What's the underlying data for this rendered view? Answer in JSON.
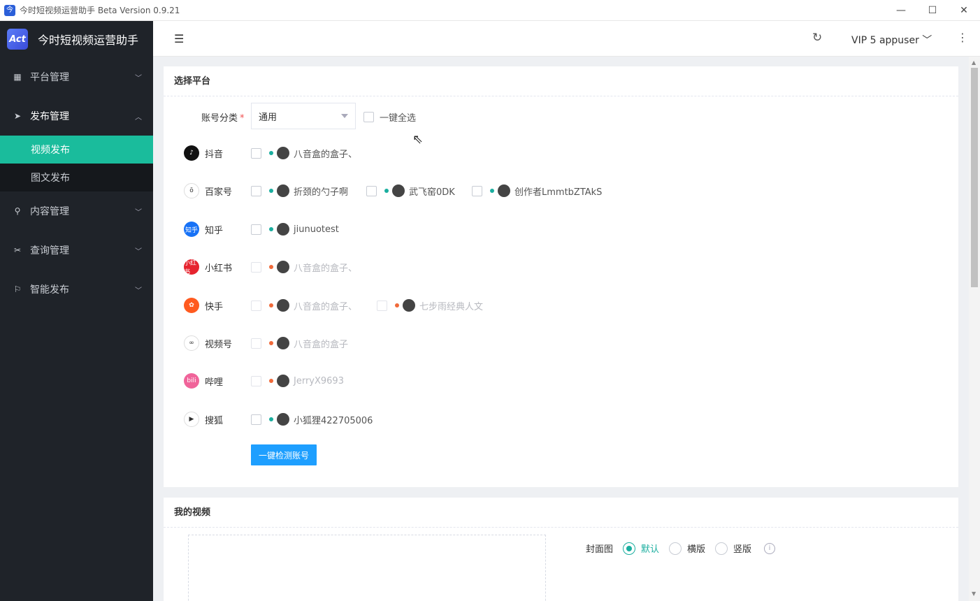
{
  "window": {
    "title": "今时短视频运营助手 Beta Version 0.9.21",
    "minimize": "—",
    "maximize": "☐",
    "close": "✕"
  },
  "sidebar": {
    "logo_text": "今时短视频运营助手",
    "logo_badge": "Act",
    "menus": [
      {
        "label": "平台管理",
        "icon": "grid-icon",
        "expanded": false
      },
      {
        "label": "发布管理",
        "icon": "send-icon",
        "expanded": true,
        "children": [
          {
            "label": "视频发布",
            "active": true
          },
          {
            "label": "图文发布",
            "active": false
          }
        ]
      },
      {
        "label": "内容管理",
        "icon": "link-icon",
        "expanded": false
      },
      {
        "label": "查询管理",
        "icon": "tools-icon",
        "expanded": false
      },
      {
        "label": "智能发布",
        "icon": "flag-icon",
        "expanded": false
      }
    ]
  },
  "topbar": {
    "user_label": "VIP 5 appuser"
  },
  "select_platform": {
    "title": "选择平台",
    "category_label": "账号分类",
    "required_mark": "*",
    "category_value": "通用",
    "select_all_label": "一键全选",
    "check_button": "一键检测账号",
    "platforms": [
      {
        "name": "抖音",
        "icon_color": "#111111",
        "icon_glyph": "♪",
        "accounts": [
          {
            "name": "八音盒的盒子、",
            "status": "ok",
            "enabled": true
          }
        ]
      },
      {
        "name": "百家号",
        "icon_color": "#ffffff",
        "icon_glyph": "ō",
        "accounts": [
          {
            "name": "折颈的勺子啊",
            "status": "ok",
            "enabled": true
          },
          {
            "name": "武飞窑0DK",
            "status": "ok",
            "enabled": true
          },
          {
            "name": "创作者LmmtbZTAkS",
            "status": "ok",
            "enabled": true
          }
        ]
      },
      {
        "name": "知乎",
        "icon_color": "#1772f6",
        "icon_glyph": "知乎",
        "accounts": [
          {
            "name": "jiunuotest",
            "status": "ok",
            "enabled": true
          }
        ]
      },
      {
        "name": "小红书",
        "icon_color": "#e6242f",
        "icon_glyph": "小红书",
        "accounts": [
          {
            "name": "八音盒的盒子、",
            "status": "bad",
            "enabled": false
          }
        ]
      },
      {
        "name": "快手",
        "icon_color": "#ff5a1f",
        "icon_glyph": "✿",
        "accounts": [
          {
            "name": "八音盒的盒子、",
            "status": "bad",
            "enabled": false
          },
          {
            "name": "七步雨经典人文",
            "status": "bad",
            "enabled": false
          }
        ]
      },
      {
        "name": "视频号",
        "icon_color": "#ffffff",
        "icon_glyph": "∞",
        "accounts": [
          {
            "name": "八音盒的盒子",
            "status": "bad",
            "enabled": false
          }
        ]
      },
      {
        "name": "哔哩",
        "icon_color": "#f0649a",
        "icon_glyph": "bili",
        "accounts": [
          {
            "name": "JerryX9693",
            "status": "bad",
            "enabled": false
          }
        ]
      },
      {
        "name": "搜狐",
        "icon_color": "#ffffff",
        "icon_glyph": "▶",
        "accounts": [
          {
            "name": "小狐狸422705006",
            "status": "ok",
            "enabled": true
          }
        ]
      }
    ]
  },
  "my_video": {
    "title": "我的视频",
    "cover_label": "封面图",
    "cover_options": [
      {
        "label": "默认",
        "selected": true
      },
      {
        "label": "横版",
        "selected": false
      },
      {
        "label": "竖版",
        "selected": false
      }
    ]
  }
}
